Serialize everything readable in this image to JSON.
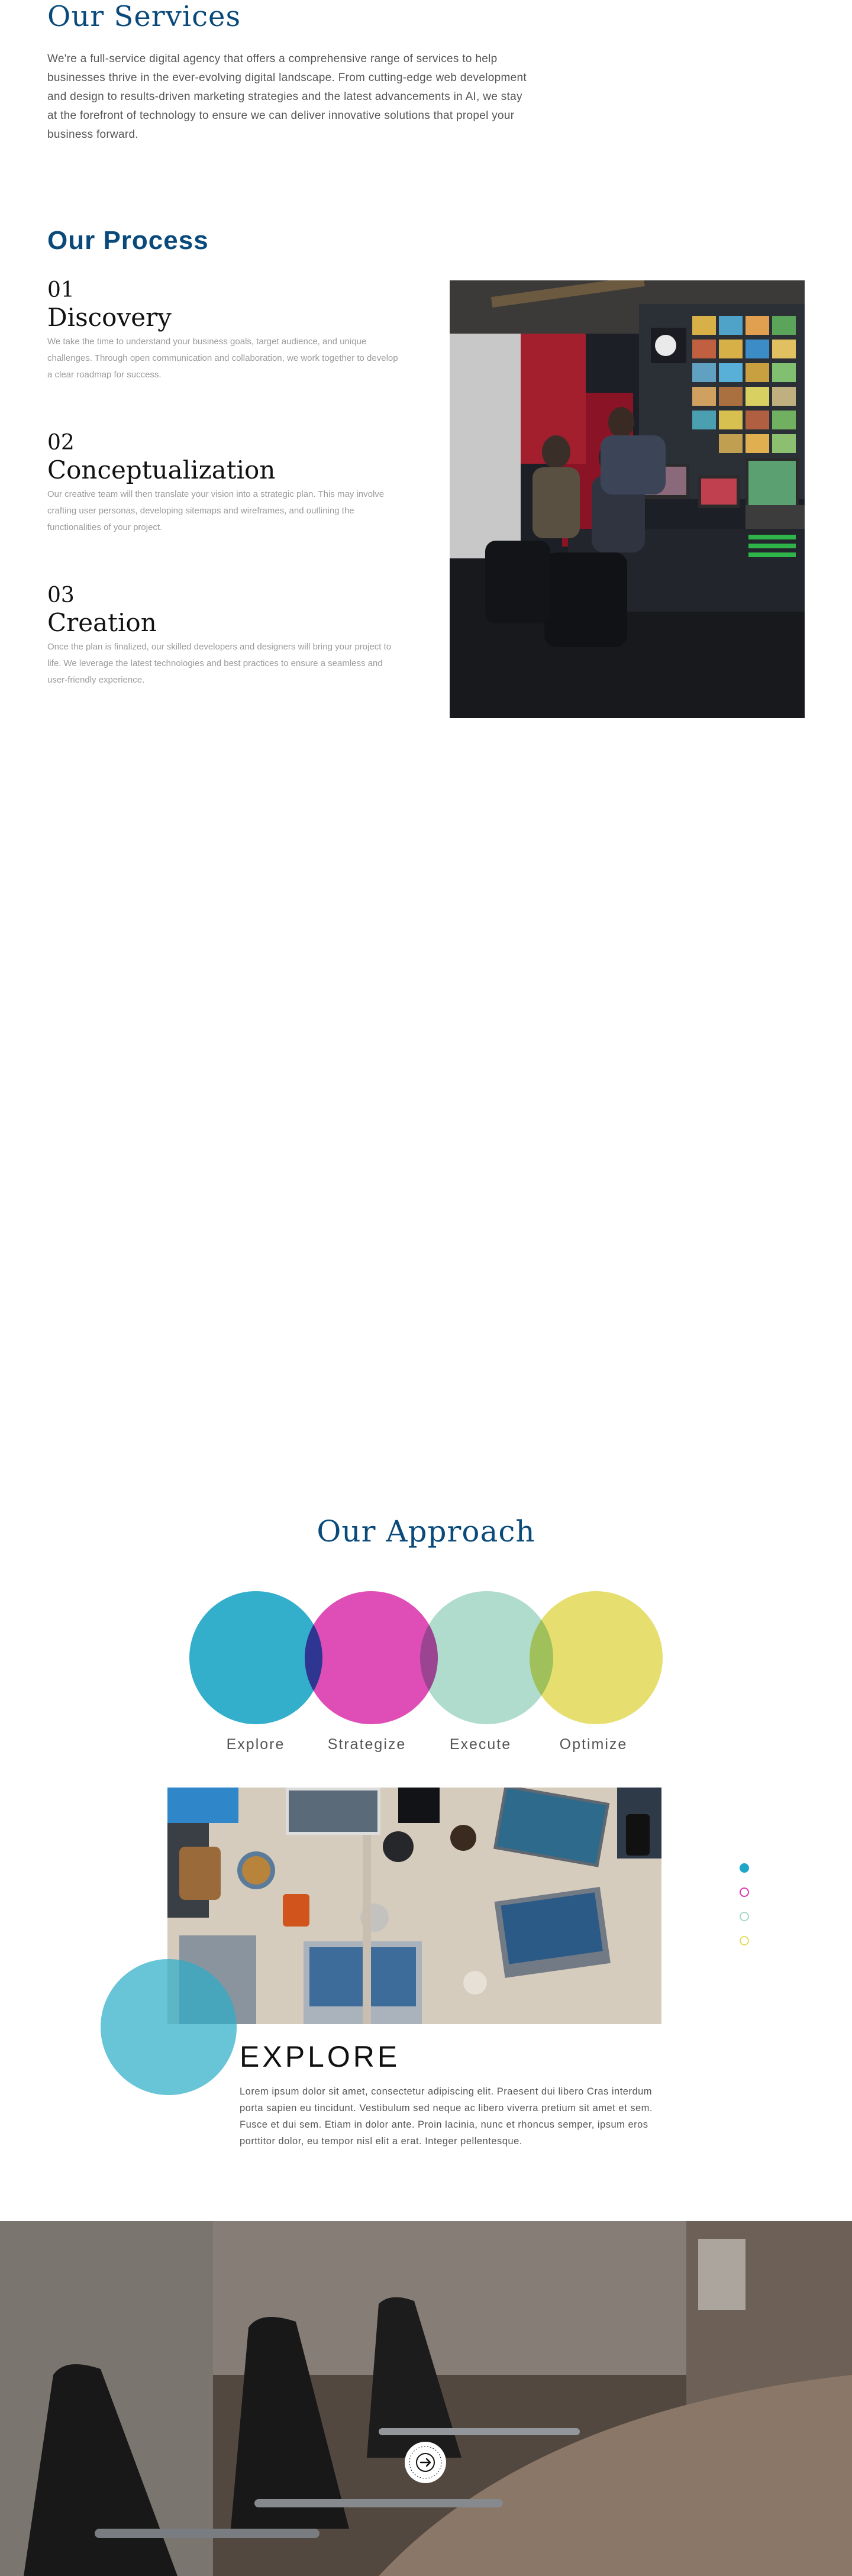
{
  "services": {
    "title": "Our Services",
    "body": "We're a full-service digital agency that offers a comprehensive range of services to help businesses thrive in the ever-evolving digital landscape. From cutting-edge web development and design to results-driven marketing strategies and the latest advancements in AI, we stay at the forefront of technology to ensure we can deliver innovative solutions that propel your business forward."
  },
  "process": {
    "title": "Our Process",
    "steps": [
      {
        "num": "01",
        "name": "Discovery",
        "desc": "We take the time to understand your business goals, target audience, and unique challenges. Through open communication and collaboration, we work together to develop a clear roadmap for success."
      },
      {
        "num": "02",
        "name": "Conceptualization",
        "desc": "Our creative team will then translate your vision into a strategic plan. This may involve crafting user personas, developing sitemaps and wireframes, and outlining the functionalities of your project."
      },
      {
        "num": "03",
        "name": "Creation",
        "desc": "Once the plan is finalized, our skilled developers and designers will bring your project to life. We leverage the latest technologies and best practices to ensure a seamless and user-friendly experience."
      }
    ]
  },
  "approach": {
    "title": "Our Approach",
    "circles": [
      {
        "label": "Explore",
        "color": "#1ea6c6"
      },
      {
        "label": "Strategize",
        "color": "#dc3aae"
      },
      {
        "label": "Execute",
        "color": "#a8d8c8"
      },
      {
        "label": "Optimize",
        "color": "#e4dc60"
      }
    ],
    "detail": {
      "title": "EXPLORE",
      "body": "Lorem ipsum dolor sit amet, consectetur adipiscing elit. Praesent dui libero Cras interdum porta sapien eu tincidunt. Vestibulum sed neque ac libero viverra pretium sit amet et sem. Fusce et dui sem. Etiam in dolor ante. Proin lacinia, nunc et rhoncus semper, ipsum eros porttitor dolor, eu tempor nisl elit a erat. Integer pellentesque."
    },
    "indicator_dots": [
      {
        "color": "#1ea6c6",
        "filled": true
      },
      {
        "color": "#dc3aae",
        "filled": false
      },
      {
        "color": "#a8d8c8",
        "filled": false
      },
      {
        "color": "#e4dc60",
        "filled": false
      }
    ]
  },
  "office": {
    "badge_icon": "arrow-right-icon"
  }
}
